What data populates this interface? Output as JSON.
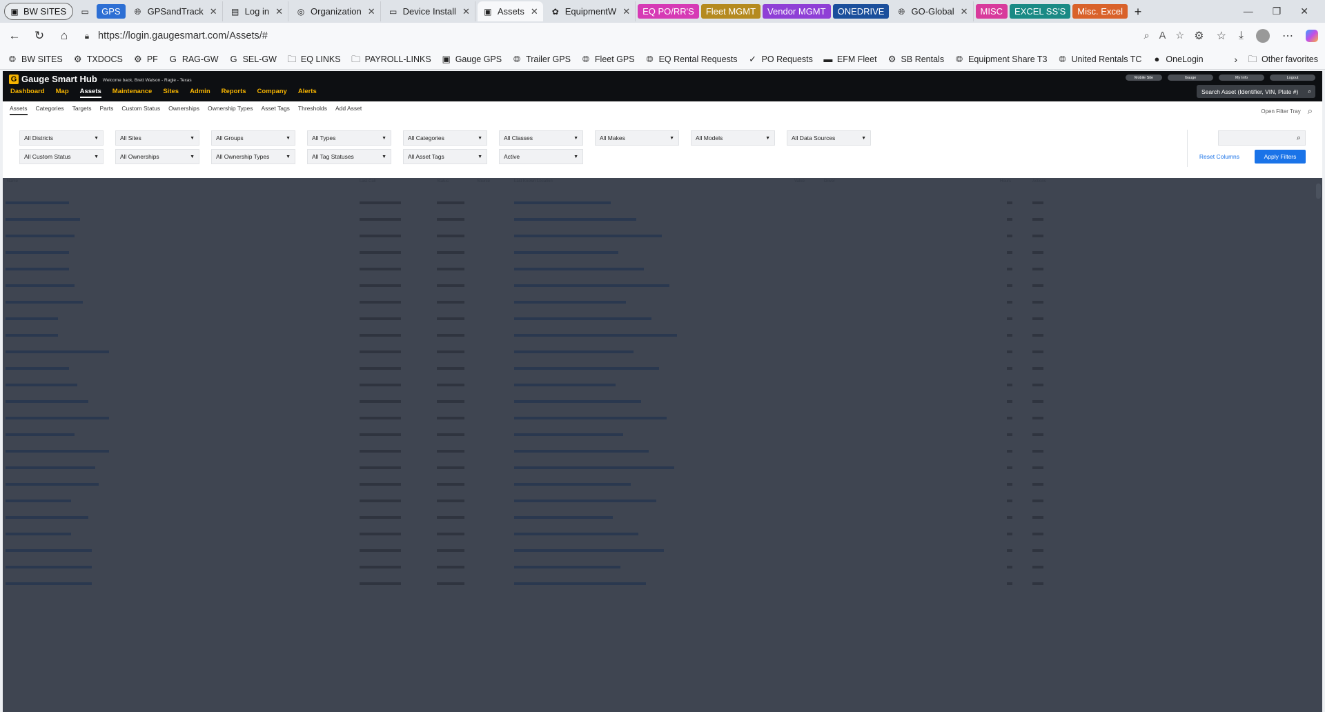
{
  "browser": {
    "profile": "BW SITES",
    "tabs": [
      {
        "label": "GPS",
        "type": "group",
        "color": "#2d6fd4"
      },
      {
        "label": "GPSandTrack",
        "type": "tab",
        "icon": "globe-icon"
      },
      {
        "label": "Log in",
        "type": "tab",
        "icon": "app-icon"
      },
      {
        "label": "Organization",
        "type": "tab",
        "icon": "org-icon"
      },
      {
        "label": "Device Install",
        "type": "tab",
        "icon": "doc-icon"
      },
      {
        "label": "Assets",
        "type": "tab",
        "active": true,
        "icon": "gauge-icon"
      },
      {
        "label": "EquipmentW",
        "type": "tab",
        "icon": "colorful-icon"
      },
      {
        "label": "EQ PO/RR'S",
        "type": "group",
        "color": "#d63ab5"
      },
      {
        "label": "Fleet MGMT",
        "type": "group",
        "color": "#b58a1f"
      },
      {
        "label": "Vendor MGMT",
        "type": "group",
        "color": "#8f3fd6"
      },
      {
        "label": "ONEDRIVE",
        "type": "group",
        "color": "#1b4f9c"
      },
      {
        "label": "GO-Global",
        "type": "tab",
        "icon": "globe-icon"
      },
      {
        "label": "MISC",
        "type": "group",
        "color": "#d83a9c"
      },
      {
        "label": "EXCEL SS'S",
        "type": "group",
        "color": "#1a8a85"
      },
      {
        "label": "Misc. Excel",
        "type": "group",
        "color": "#d9622a"
      }
    ],
    "url": "https://login.gaugesmart.com/Assets/#",
    "bookmarks": [
      {
        "label": "BW SITES",
        "icon": "globe-icon"
      },
      {
        "label": "TXDOCS",
        "icon": "gear-icon"
      },
      {
        "label": "PF",
        "icon": "gear-icon"
      },
      {
        "label": "RAG-GW",
        "icon": "g-icon"
      },
      {
        "label": "SEL-GW",
        "icon": "g-icon"
      },
      {
        "label": "EQ LINKS",
        "icon": "folder-icon"
      },
      {
        "label": "PAYROLL-LINKS",
        "icon": "folder-icon"
      },
      {
        "label": "Gauge GPS",
        "icon": "gauge-icon"
      },
      {
        "label": "Trailer GPS",
        "icon": "globe-icon"
      },
      {
        "label": "Fleet GPS",
        "icon": "globe-icon"
      },
      {
        "label": "EQ Rental Requests",
        "icon": "globe-icon"
      },
      {
        "label": "PO Requests",
        "icon": "check-icon"
      },
      {
        "label": "EFM Fleet",
        "icon": "efm-icon"
      },
      {
        "label": "SB Rentals",
        "icon": "gear-icon"
      },
      {
        "label": "Equipment Share T3",
        "icon": "globe-icon"
      },
      {
        "label": "United Rentals TC",
        "icon": "globe-icon"
      },
      {
        "label": "OneLogin",
        "icon": "circle-icon"
      }
    ],
    "other_favorites": "Other favorites"
  },
  "app": {
    "logo": "Gauge Smart Hub",
    "welcome": "Welcome back, Brett Watson - Ragle - Texas",
    "nav": [
      "Dashboard",
      "Map",
      "Maintenance",
      "Sites",
      "Admin",
      "Reports",
      "Company",
      "Alerts"
    ],
    "nav_active": "Assets",
    "top_buttons": [
      "Mobile Site",
      "Gauge",
      "My Info",
      "Logout"
    ],
    "search_placeholder": "Search Asset (Identifier, VIN, Plate #)",
    "subnav": [
      "Assets",
      "Categories",
      "Targets",
      "Parts",
      "Custom Status",
      "Ownerships",
      "Ownership Types",
      "Asset Tags",
      "Thresholds",
      "Add Asset"
    ],
    "filter_tray": "Open Filter Tray",
    "filters_row1": [
      "All Districts",
      "All Sites",
      "All Groups",
      "All Types",
      "All Categories",
      "All Classes",
      "All Makes",
      "All Models",
      "All Data Sources"
    ],
    "filters_row2": [
      "All Custom Status",
      "All Ownerships",
      "All Ownership Types",
      "All Tag Statuses",
      "All Asset Tags",
      "Active"
    ],
    "reset_columns": "Reset Columns",
    "apply_filters": "Apply Filters",
    "table_headers": [
      "Name",
      "Last Call",
      "Status",
      "Source",
      "Last Known Location",
      "Value",
      "Driver",
      "Hours",
      "Actions"
    ]
  },
  "colors": {
    "accent": "#f6b400",
    "primary": "#1a73e8",
    "appbar": "#0d0f12"
  }
}
